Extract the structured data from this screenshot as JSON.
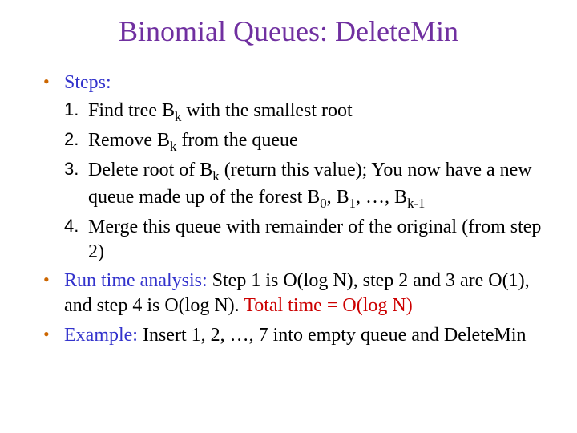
{
  "colors": {
    "title": "#7030A0",
    "bullet": "#CC6600",
    "blue_label": "#3333CC",
    "red_label": "#CC0000",
    "body": "#000000"
  },
  "title": "Binomial Queues: DeleteMin",
  "bullets": {
    "steps_label": "Steps:",
    "steps": [
      {
        "pre": "Find tree B",
        "sub": "k",
        "post": " with the smallest root"
      },
      {
        "pre": "Remove B",
        "sub": "k",
        "post": " from the queue"
      },
      {
        "pre": "Delete root of B",
        "sub": "k",
        "post": " (return this value); You now now have a new queue made up of the forest B",
        "_ignore": ""
      }
    ],
    "step3_part1": "Delete root of B",
    "step3_sub1": "k",
    "step3_mid": " (return this value); You now have a new queue made up of the forest B",
    "step3_sub2": "0",
    "step3_c1": ", B",
    "step3_sub3": "1",
    "step3_c2": ", …, B",
    "step3_sub4": "k-1",
    "step4": "Merge this queue with remainder of the original (from step 2)",
    "runtime_label": "Run time analysis:",
    "runtime_body": " Step 1 is O(log N), step 2 and 3 are O(1), and step 4 is O(log N). ",
    "runtime_total": "Total time = O(log N)",
    "example_label": "Example:",
    "example_body": " Insert 1, 2, …, 7 into empty queue and DeleteMin"
  }
}
